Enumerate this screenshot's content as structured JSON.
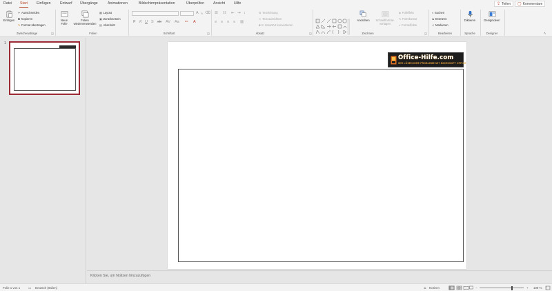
{
  "tabs": [
    {
      "label": "Datei",
      "active": false
    },
    {
      "label": "Start",
      "active": true
    },
    {
      "label": "Einfügen",
      "active": false
    },
    {
      "label": "Entwurf",
      "active": false
    },
    {
      "label": "Übergänge",
      "active": false
    },
    {
      "label": "Animationen",
      "active": false
    },
    {
      "label": "Bildschirmpräsentation",
      "active": false
    },
    {
      "label": "Überprüfen",
      "active": false
    },
    {
      "label": "Ansicht",
      "active": false
    },
    {
      "label": "Hilfe",
      "active": false
    }
  ],
  "share": {
    "teilen": "Teilen",
    "kommentare": "Kommentare"
  },
  "ribbon": {
    "clipboard": {
      "paste": "Einfügen",
      "cut": "Ausschneiden",
      "copy": "Kopieren",
      "format_painter": "Format übertragen",
      "group": "Zwischenablage"
    },
    "slides": {
      "new_slide": "Neue",
      "new_slide_2": "Folie",
      "reuse": "Folien",
      "reuse_2": "wiederverwenden",
      "layout": "Layout",
      "reset": "Zurücksetzen",
      "section": "Abschnitt",
      "group": "Folien"
    },
    "font": {
      "bold": "F",
      "italic": "K",
      "underline": "U",
      "strike": "S",
      "shadow": "ab",
      "spacing": "AV",
      "case": "Aa",
      "group": "Schriftart"
    },
    "paragraph": {
      "text_direction": "Textrichtung",
      "align_text": "Text ausrichten",
      "smartart": "In SmartArt konvertieren",
      "group": "Absatz"
    },
    "drawing": {
      "arrange": "Anordnen",
      "quick_styles": "Schnellformat-",
      "quick_styles_2": "vorlagen",
      "fill": "Fülleffekt",
      "outline": "Formkontur",
      "effects": "Formeffekte",
      "group": "Zeichnen"
    },
    "editing": {
      "find": "Suchen",
      "replace": "Ersetzen",
      "select": "Markieren",
      "group": "Bearbeiten"
    },
    "voice": {
      "dictate": "Diktieren",
      "group": "Sprache"
    },
    "designer": {
      "ideas": "Designideen",
      "group": "Designer"
    }
  },
  "thumbnails": [
    {
      "number": "1"
    }
  ],
  "slide": {
    "logo_title": "Office-Hilfe.com",
    "logo_subtitle": "WIR LÖSEN IHRE PROBLEME MIT MICROSOFT OFFICE"
  },
  "notes_placeholder": "Klicken Sie, um Notizen hinzuzufügen",
  "status": {
    "slide_count": "Folie 1 von 1",
    "language": "Deutsch (Italien)",
    "notes": "Notizen",
    "zoom": "109 %"
  },
  "colors": {
    "accent": "#b7472a",
    "selection": "#9c2a35"
  }
}
